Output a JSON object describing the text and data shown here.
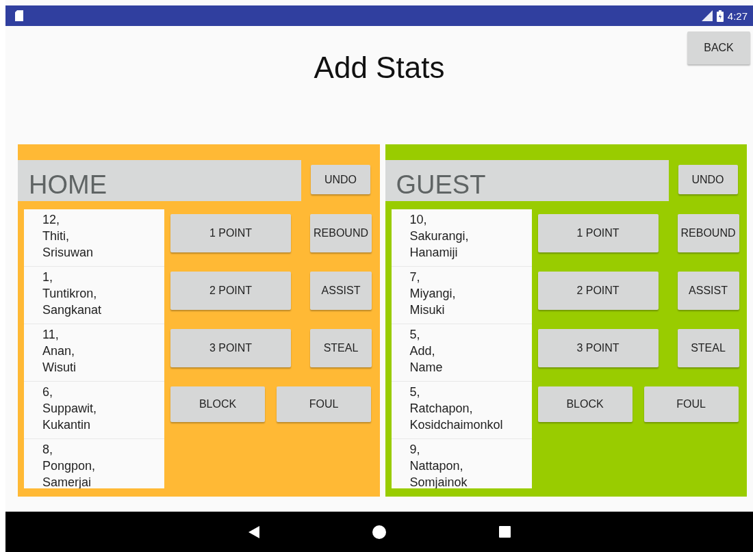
{
  "status_bar": {
    "time": "4:27"
  },
  "title": "Add Stats",
  "back_button": "BACK",
  "teams": [
    {
      "name": "HOME",
      "color": "#ffb935",
      "undo": "UNDO",
      "players": [
        {
          "lines": [
            "12,",
            "Thiti,",
            "Srisuwan"
          ]
        },
        {
          "lines": [
            "1,",
            "Tuntikron,",
            "Sangkanat"
          ]
        },
        {
          "lines": [
            "11,",
            "Anan,",
            "Wisuti"
          ]
        },
        {
          "lines": [
            "6,",
            "Suppawit,",
            "Kukantin"
          ]
        },
        {
          "lines": [
            "8,",
            "Pongpon,",
            "Samerjai"
          ]
        }
      ],
      "action_rows": [
        {
          "kind": "score",
          "buttons": [
            "1 POINT",
            "REBOUND"
          ]
        },
        {
          "kind": "score",
          "buttons": [
            "2 POINT",
            "ASSIST"
          ]
        },
        {
          "kind": "score",
          "buttons": [
            "3 POINT",
            "STEAL"
          ]
        },
        {
          "kind": "even",
          "buttons": [
            "BLOCK",
            "FOUL"
          ]
        }
      ]
    },
    {
      "name": "GUEST",
      "color": "#99cc00",
      "undo": "UNDO",
      "players": [
        {
          "lines": [
            "10,",
            "Sakurangi,",
            "Hanamiji"
          ]
        },
        {
          "lines": [
            "7,",
            "Miyangi,",
            "Misuki"
          ]
        },
        {
          "lines": [
            "5,",
            "Add,",
            "Name"
          ]
        },
        {
          "lines": [
            "5,",
            "Ratchapon,",
            "Kosidchaimonkol"
          ]
        },
        {
          "lines": [
            "9,",
            "Nattapon,",
            "Somjainok"
          ]
        }
      ],
      "action_rows": [
        {
          "kind": "score",
          "buttons": [
            "1 POINT",
            "REBOUND"
          ]
        },
        {
          "kind": "score",
          "buttons": [
            "2 POINT",
            "ASSIST"
          ]
        },
        {
          "kind": "score",
          "buttons": [
            "3 POINT",
            "STEAL"
          ]
        },
        {
          "kind": "even",
          "buttons": [
            "BLOCK",
            "FOUL"
          ]
        }
      ]
    }
  ]
}
